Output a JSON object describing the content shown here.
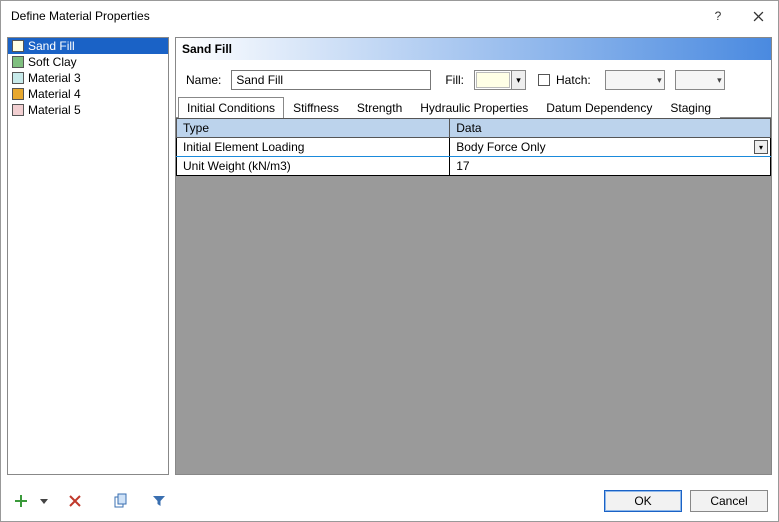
{
  "window": {
    "title": "Define Material Properties"
  },
  "materials": [
    {
      "name": "Sand Fill",
      "color": "#ffffe6",
      "selected": true
    },
    {
      "name": "Soft Clay",
      "color": "#7fbf7f",
      "selected": false
    },
    {
      "name": "Material 3",
      "color": "#c7eaea",
      "selected": false
    },
    {
      "name": "Material 4",
      "color": "#e8a82e",
      "selected": false
    },
    {
      "name": "Material 5",
      "color": "#f2cfd1",
      "selected": false
    }
  ],
  "header": {
    "current_material": "Sand Fill"
  },
  "form": {
    "name_label": "Name:",
    "name_value": "Sand Fill",
    "fill_label": "Fill:",
    "fill_color": "#ffffe6",
    "hatch_label": "Hatch:",
    "hatch_checked": false
  },
  "tabs": [
    "Initial Conditions",
    "Stiffness",
    "Strength",
    "Hydraulic Properties",
    "Datum Dependency",
    "Staging"
  ],
  "active_tab": 0,
  "grid": {
    "columns": [
      "Type",
      "Data"
    ],
    "rows": [
      {
        "type": "Initial Element Loading",
        "data": "Body Force Only"
      },
      {
        "type": "Unit Weight (kN/m3)",
        "data": "17"
      }
    ]
  },
  "buttons": {
    "ok": "OK",
    "cancel": "Cancel"
  }
}
